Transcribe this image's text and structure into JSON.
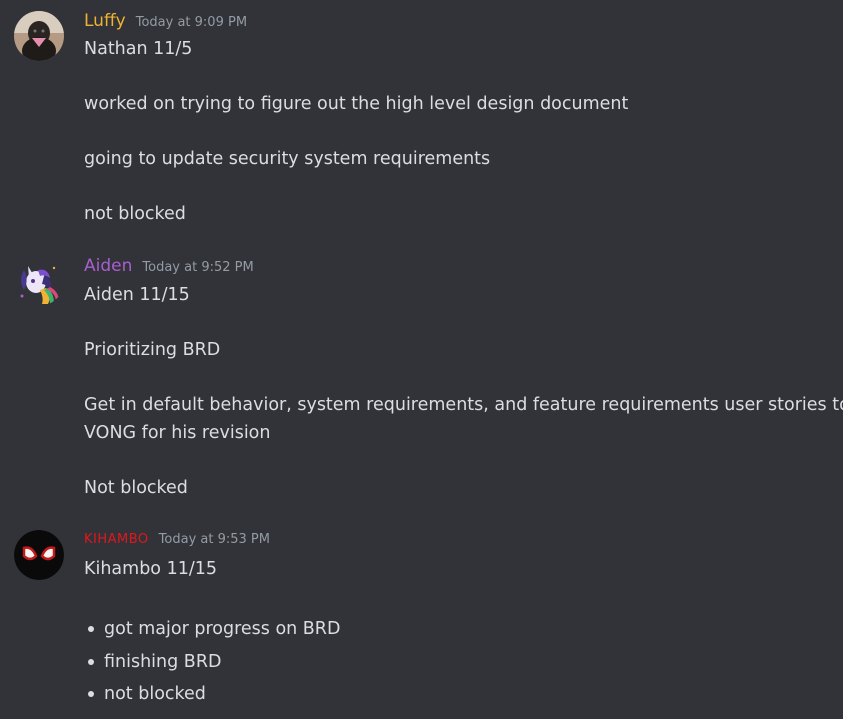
{
  "messages": [
    {
      "username": "Luffy",
      "username_color": "#f0b232",
      "timestamp": "Today at 9:09 PM",
      "avatar_icon": "dog-avatar-icon",
      "lines": [
        "Nathan 11/5",
        "worked on trying to figure out the high level design document",
        "going to update security system requirements",
        "not blocked"
      ]
    },
    {
      "username": "Aiden",
      "username_color": "#a95ecf",
      "timestamp": "Today at 9:52 PM",
      "avatar_icon": "unicorn-avatar-icon",
      "lines": [
        "Aiden 11/15",
        "Prioritizing BRD",
        "Get in default behavior, system requirements, and feature requirements user stories to",
        "VONG for his revision",
        "Not blocked"
      ]
    },
    {
      "username": "KIHAMBO",
      "username_color": "#e1171e",
      "timestamp": "Today at 9:53 PM",
      "avatar_icon": "spider-mask-avatar-icon",
      "lines": [
        "Kihambo 11/15"
      ],
      "bullets": [
        "got major progress on BRD",
        "finishing BRD",
        "not blocked"
      ]
    }
  ]
}
